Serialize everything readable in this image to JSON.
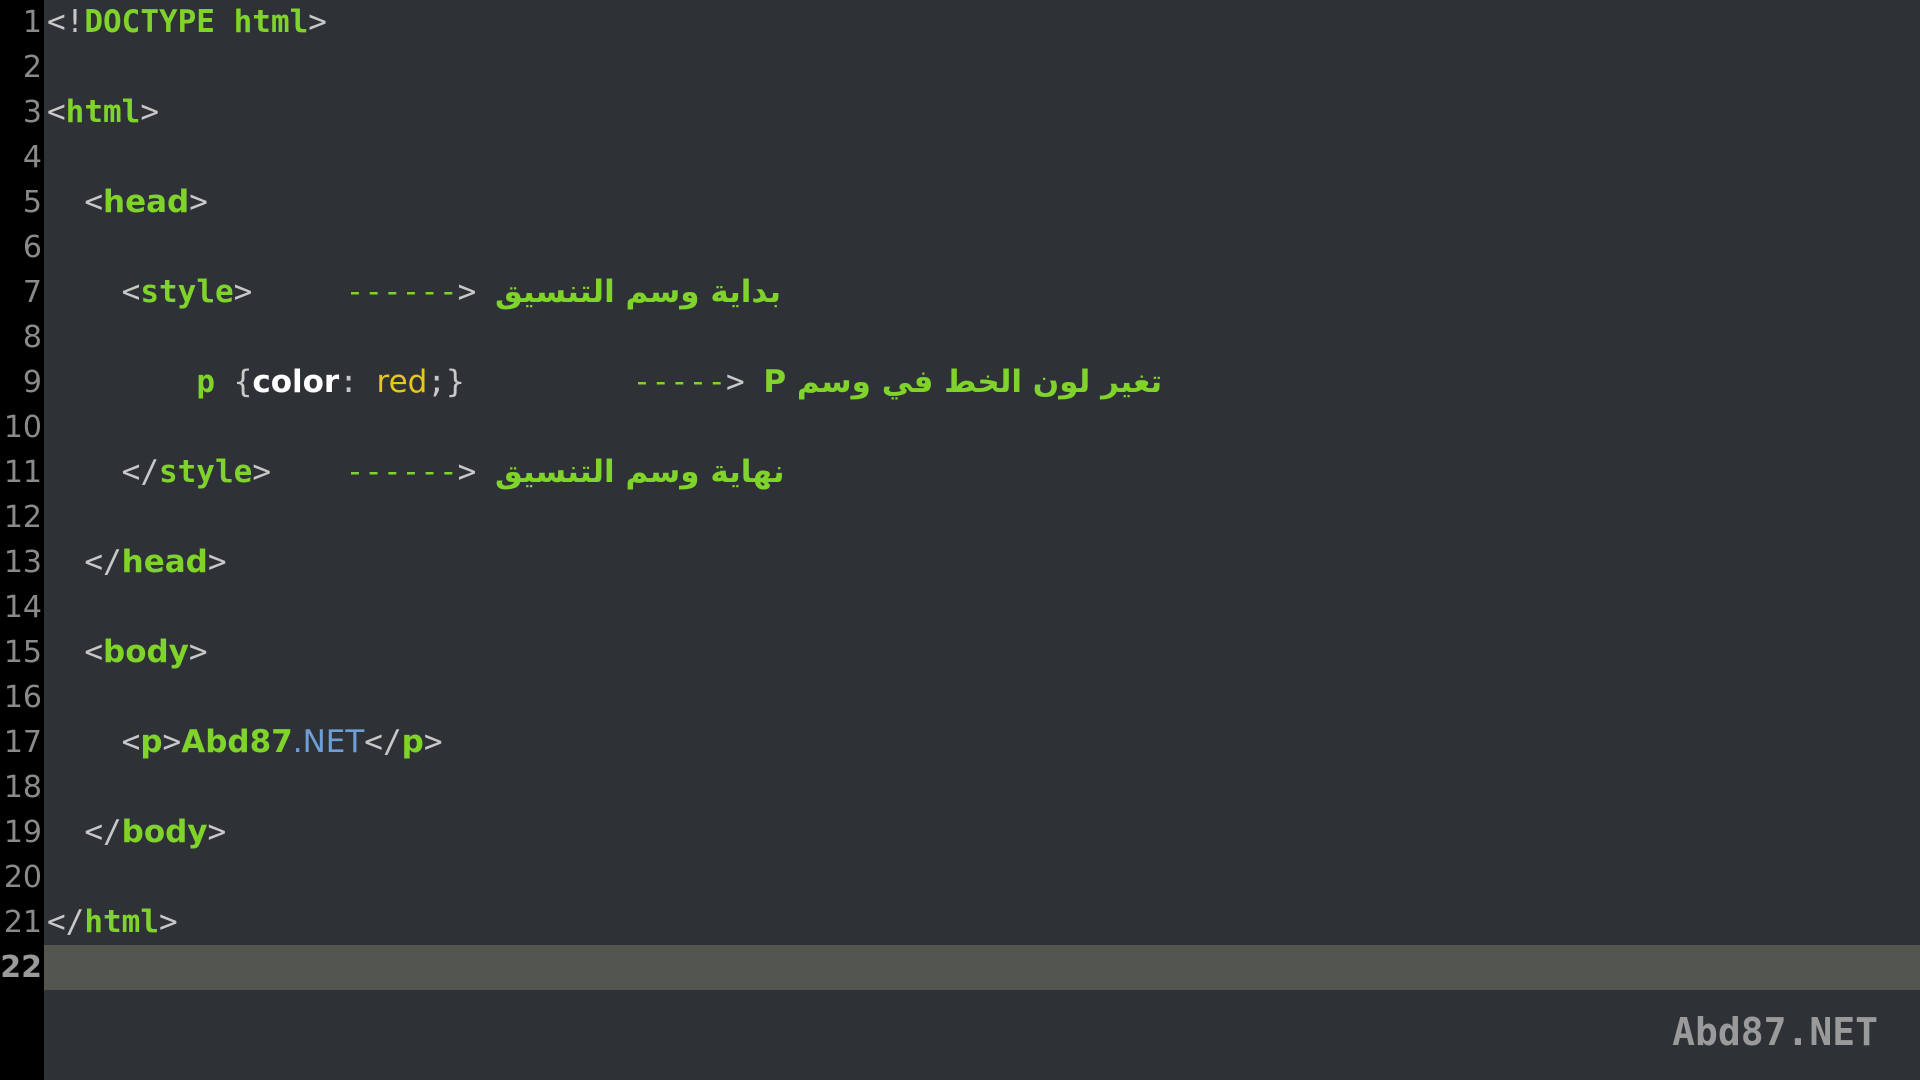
{
  "editor": {
    "line_numbers": [
      "1",
      "2",
      "3",
      "4",
      "5",
      "6",
      "7",
      "8",
      "9",
      "10",
      "11",
      "12",
      "13",
      "14",
      "15",
      "16",
      "17",
      "18",
      "19",
      "20",
      "21",
      "22"
    ],
    "current_line": "22",
    "l1": {
      "open": "<!",
      "tag": "DOCTYPE html",
      "close": ">"
    },
    "l3": {
      "open": "<",
      "tag": "html",
      "close": ">"
    },
    "l5": {
      "indent": "  ",
      "open": "<",
      "tag": "head",
      "close": ">"
    },
    "l7": {
      "indent": "    ",
      "open": "<",
      "tag": "style",
      "close": ">",
      "gap": "     ",
      "dashes": "------",
      "arrow": ">",
      "comment": "بداية وسم التنسيق"
    },
    "l9": {
      "indent": "        ",
      "selector": "p",
      "brace_open": " {",
      "prop": "color",
      "colon": ": ",
      "val": "red",
      "end": ";}",
      "gap": "         ",
      "dashes": "-----",
      "arrow": ">",
      "comment": "تغير لون الخط في وسم P"
    },
    "l11": {
      "indent": "    ",
      "open": "</",
      "tag": "style",
      "close": ">",
      "gap": "    ",
      "dashes": "------",
      "arrow": ">",
      "comment": "نهاية وسم التنسيق"
    },
    "l13": {
      "indent": "  ",
      "open": "</",
      "tag": "head",
      "close": ">"
    },
    "l15": {
      "indent": "  ",
      "open": "<",
      "tag": "body",
      "close": ">"
    },
    "l17": {
      "indent": "    ",
      "open": "<",
      "tag": "p",
      "close": ">",
      "text": "Abd87",
      "text_blue": ".NET",
      "open2": "</",
      "tag2": "p",
      "close2": ">"
    },
    "l19": {
      "indent": "  ",
      "open": "</",
      "tag": "body",
      "close": ">"
    },
    "l21": {
      "open": "</",
      "tag": "html",
      "close": ">"
    }
  },
  "watermark": "Abd87.NET",
  "colors": {
    "background": "#2e3236",
    "gutter": "#000000",
    "tag": "#7fd32a",
    "value": "#e6c619",
    "blue": "#6f9fd8",
    "current_line": "#53564f"
  }
}
